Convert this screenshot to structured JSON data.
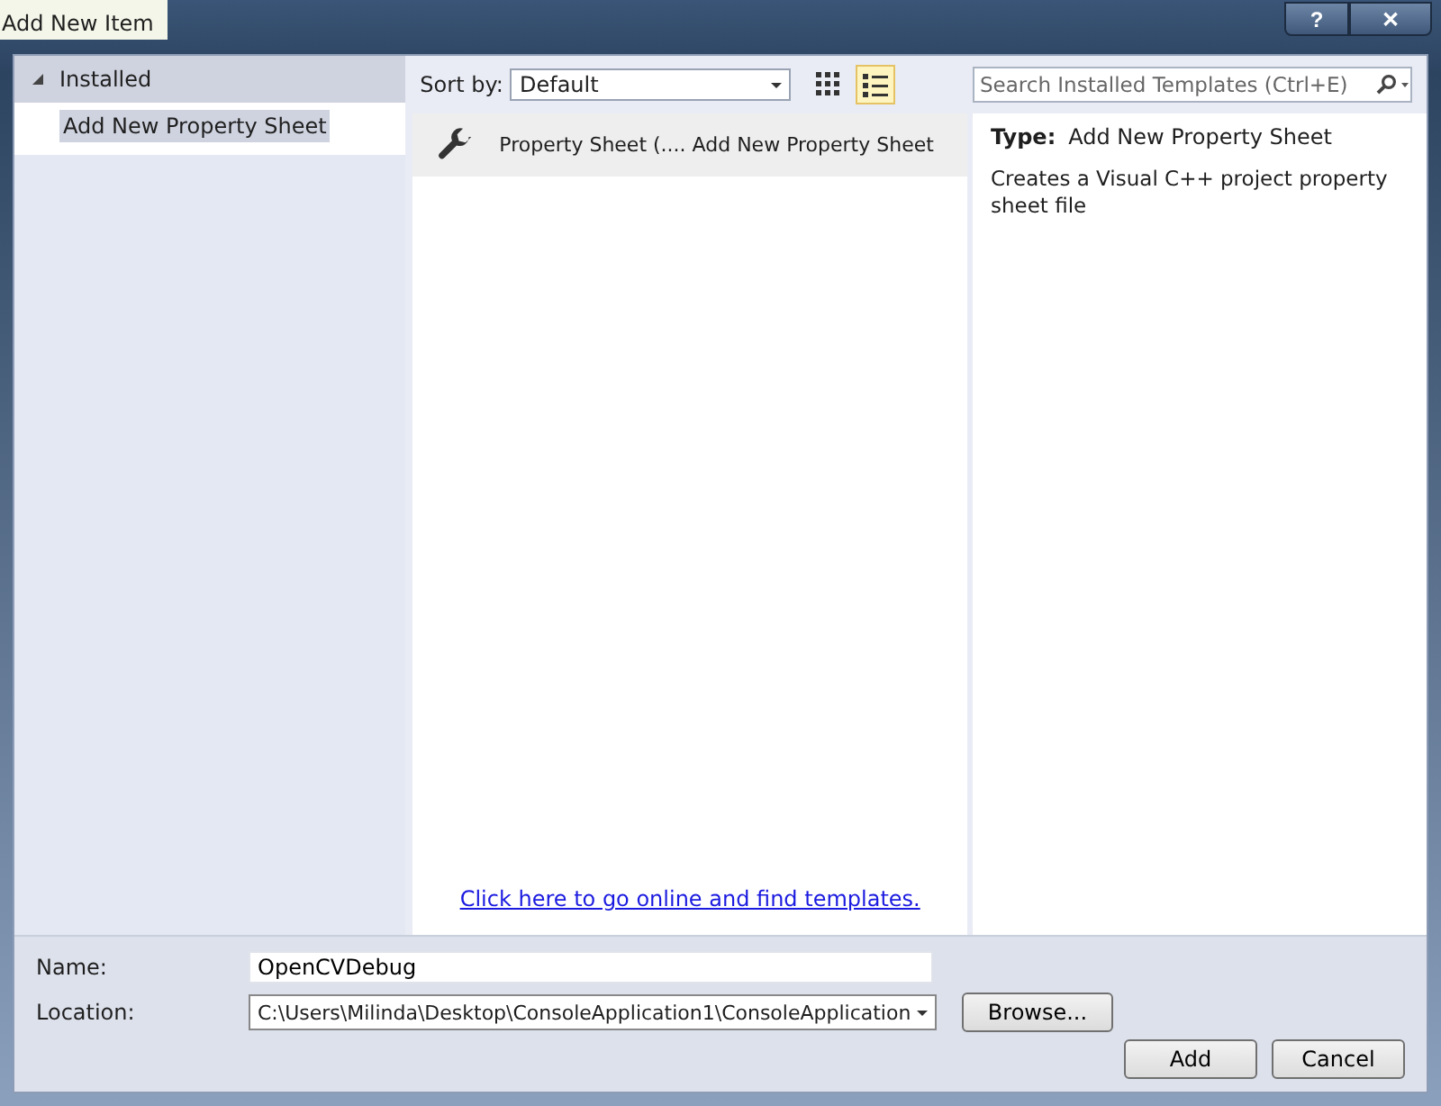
{
  "window": {
    "title": "Add New Item",
    "buttons": [
      "?",
      "✕"
    ]
  },
  "sidebar": {
    "items": [
      {
        "label": "Installed",
        "expanded": true,
        "selected": false,
        "children": [
          {
            "label": "Add New Property Sheet",
            "selected": true
          }
        ]
      }
    ]
  },
  "toolbar": {
    "sort_label": "Sort by:",
    "sort_value": "Default",
    "views": [
      {
        "kind": "grid",
        "selected": false
      },
      {
        "kind": "list",
        "selected": true
      }
    ],
    "search": {
      "placeholder": "Search Installed Templates (Ctrl+E)"
    }
  },
  "templates": [
    {
      "name": "Property Sheet (.... Add New Property Sheet",
      "selected": true
    }
  ],
  "online_link": "Click here to go online and find templates.",
  "details": {
    "type_label": "Type:",
    "type_value": "Add New Property Sheet",
    "description": "Creates a Visual C++ project property sheet file"
  },
  "form": {
    "name_label": "Name:",
    "name_value": "OpenCVDebug",
    "location_label": "Location:",
    "location_value": "C:\\Users\\Milinda\\Desktop\\ConsoleApplication1\\ConsoleApplication",
    "browse": "Browse..."
  },
  "buttons": [
    "Add",
    "Cancel"
  ]
}
